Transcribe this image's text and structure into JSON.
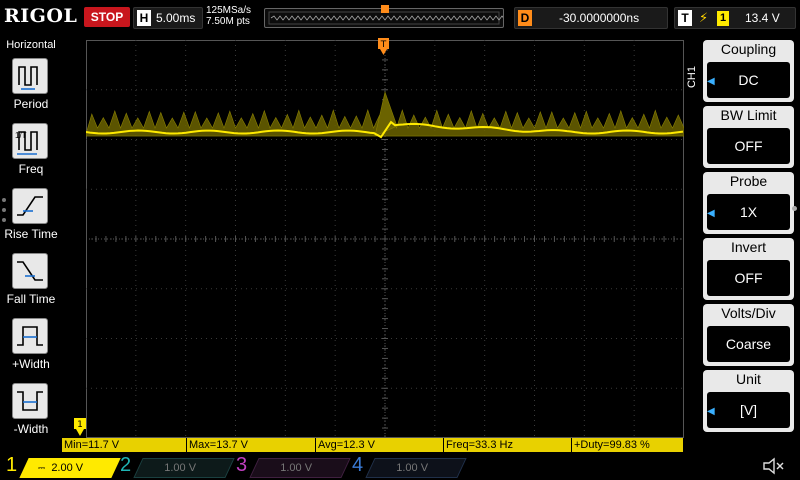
{
  "header": {
    "brand": "RIGOL",
    "run_state": "STOP",
    "horizontal_tag": "H",
    "timebase": "5.00ms",
    "sample_rate": "125MSa/s",
    "memory_depth": "7.50M pts",
    "delay_tag": "D",
    "delay": "-30.0000000ns",
    "trigger_tag": "T",
    "trigger_source": "1",
    "trigger_level": "13.4 V"
  },
  "left_panel": {
    "title": "Horizontal",
    "items": [
      {
        "label": "Period",
        "icon": "period-icon"
      },
      {
        "label": "Freq",
        "icon": "freq-icon"
      },
      {
        "label": "Rise Time",
        "icon": "rise-time-icon"
      },
      {
        "label": "Fall Time",
        "icon": "fall-time-icon"
      },
      {
        "label": "+Width",
        "icon": "pos-width-icon"
      },
      {
        "label": "-Width",
        "icon": "neg-width-icon"
      }
    ]
  },
  "right_menu": {
    "channel_label": "CH1",
    "items": [
      {
        "title": "Coupling",
        "value": "DC",
        "arrow": true
      },
      {
        "title": "BW Limit",
        "value": "OFF",
        "arrow": false
      },
      {
        "title": "Probe",
        "value": "1X",
        "arrow": true
      },
      {
        "title": "Invert",
        "value": "OFF",
        "arrow": false
      },
      {
        "title": "Volts/Div",
        "value": "Coarse",
        "arrow": false
      },
      {
        "title": "Unit",
        "value": "[V]",
        "arrow": true
      }
    ]
  },
  "measurements": [
    "Min=11.7 V",
    "Max=13.7 V",
    "Avg=12.3 V",
    "Freq=33.3 Hz",
    "+Duty=99.83 %"
  ],
  "channels": [
    {
      "num": "1",
      "scale": "2.00 V",
      "color": "#ffea00",
      "active": true
    },
    {
      "num": "2",
      "scale": "1.00 V",
      "color": "#1fb5b5",
      "active": false
    },
    {
      "num": "3",
      "scale": "1.00 V",
      "color": "#c040c0",
      "active": false
    },
    {
      "num": "4",
      "scale": "1.00 V",
      "color": "#3a7bd5",
      "active": false
    }
  ],
  "waveform": {
    "color": "#ffea00",
    "baseline_volts": 12.3,
    "trigger_time_div": 0.0
  }
}
